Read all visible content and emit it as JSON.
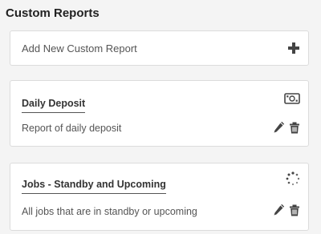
{
  "page": {
    "title": "Custom Reports"
  },
  "add_card": {
    "label": "Add New Custom Report",
    "icon": "plus-icon"
  },
  "reports": [
    {
      "title": "Daily Deposit",
      "description": "Report of daily deposit",
      "type_icon": "money-bill-icon",
      "actions": [
        "edit-pencil-icon",
        "trash-icon"
      ]
    },
    {
      "title": "Jobs - Standby and Upcoming",
      "description": "All jobs that are in standby or upcoming",
      "type_icon": "spinner-icon",
      "actions": [
        "edit-pencil-icon",
        "trash-icon"
      ]
    }
  ],
  "colors": {
    "background": "#f4f4f4",
    "card": "#ffffff",
    "icon": "#444444"
  }
}
